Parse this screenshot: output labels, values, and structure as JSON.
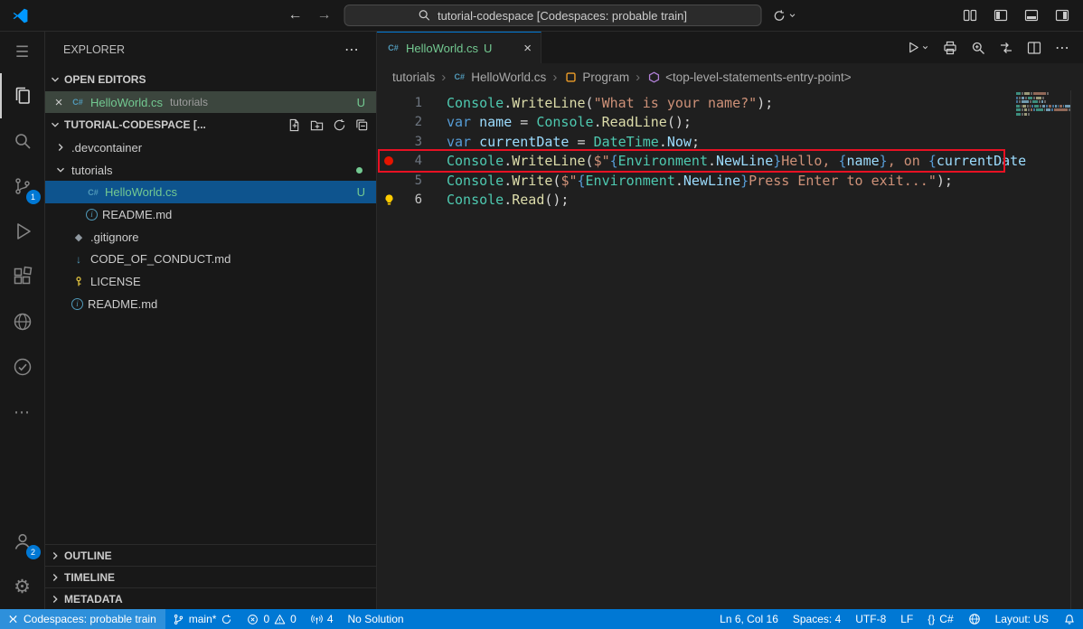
{
  "titlebar": {
    "search": "tutorial-codespace [Codespaces: probable train]"
  },
  "activitybar": {
    "scm_badge": "1",
    "account_badge": "2"
  },
  "explorer": {
    "title": "EXPLORER",
    "open_editors_label": "OPEN EDITORS",
    "open_editor": {
      "name": "HelloWorld.cs",
      "desc": "tutorials",
      "git": "U"
    },
    "workspace_label": "TUTORIAL-CODESPACE [...",
    "tree": [
      {
        "name": ".devcontainer",
        "kind": "folder",
        "expanded": false,
        "indent": 0
      },
      {
        "name": "tutorials",
        "kind": "folder",
        "expanded": true,
        "indent": 0,
        "dot": true
      },
      {
        "name": "HelloWorld.cs",
        "kind": "file",
        "icon": "csharp",
        "indent": 1,
        "selected": true,
        "git": "U"
      },
      {
        "name": "README.md",
        "kind": "file",
        "icon": "info",
        "indent": 1
      },
      {
        "name": ".gitignore",
        "kind": "file",
        "icon": "git",
        "indent": 0
      },
      {
        "name": "CODE_OF_CONDUCT.md",
        "kind": "file",
        "icon": "markdown",
        "indent": 0
      },
      {
        "name": "LICENSE",
        "kind": "file",
        "icon": "license",
        "indent": 0
      },
      {
        "name": "README.md",
        "kind": "file",
        "icon": "info",
        "indent": 0
      }
    ],
    "bottom_sections": [
      "OUTLINE",
      "TIMELINE",
      "METADATA"
    ]
  },
  "editor": {
    "tab": {
      "label": "HelloWorld.cs",
      "git": "U"
    },
    "breadcrumbs": [
      {
        "label": "tutorials",
        "icon": ""
      },
      {
        "label": "HelloWorld.cs",
        "icon": "csharp"
      },
      {
        "label": "Program",
        "icon": "class"
      },
      {
        "label": "<top-level-statements-entry-point>",
        "icon": "method"
      }
    ],
    "code": [
      {
        "deco": "",
        "tokens": [
          [
            "c",
            "Console"
          ],
          [
            "p",
            "."
          ],
          [
            "f",
            "WriteLine"
          ],
          [
            "p",
            "("
          ],
          [
            "s",
            "\"What is your name?\""
          ],
          [
            "p",
            ");"
          ]
        ]
      },
      {
        "deco": "",
        "tokens": [
          [
            "k",
            "var"
          ],
          [
            "p",
            " "
          ],
          [
            "v",
            "name"
          ],
          [
            "p",
            " = "
          ],
          [
            "c",
            "Console"
          ],
          [
            "p",
            "."
          ],
          [
            "f",
            "ReadLine"
          ],
          [
            "p",
            "();"
          ]
        ]
      },
      {
        "deco": "",
        "tokens": [
          [
            "k",
            "var"
          ],
          [
            "p",
            " "
          ],
          [
            "v",
            "currentDate"
          ],
          [
            "p",
            " = "
          ],
          [
            "c",
            "DateTime"
          ],
          [
            "p",
            "."
          ],
          [
            "v",
            "Now"
          ],
          [
            "p",
            ";"
          ]
        ]
      },
      {
        "deco": "breakpoint",
        "tokens": [
          [
            "c",
            "Console"
          ],
          [
            "p",
            "."
          ],
          [
            "f",
            "WriteLine"
          ],
          [
            "p",
            "("
          ],
          [
            "s",
            "$\""
          ],
          [
            "b",
            "{"
          ],
          [
            "c",
            "Environment"
          ],
          [
            "p",
            "."
          ],
          [
            "v",
            "NewLine"
          ],
          [
            "b",
            "}"
          ],
          [
            "s",
            "Hello, "
          ],
          [
            "b",
            "{"
          ],
          [
            "v",
            "name"
          ],
          [
            "b",
            "}"
          ],
          [
            "s",
            ", on "
          ],
          [
            "b",
            "{"
          ],
          [
            "v",
            "currentDate"
          ]
        ]
      },
      {
        "deco": "",
        "tokens": [
          [
            "c",
            "Console"
          ],
          [
            "p",
            "."
          ],
          [
            "f",
            "Write"
          ],
          [
            "p",
            "("
          ],
          [
            "s",
            "$\""
          ],
          [
            "b",
            "{"
          ],
          [
            "c",
            "Environment"
          ],
          [
            "p",
            "."
          ],
          [
            "v",
            "NewLine"
          ],
          [
            "b",
            "}"
          ],
          [
            "s",
            "Press Enter to exit...\""
          ],
          [
            "p",
            ");"
          ]
        ]
      },
      {
        "deco": "lightbulb",
        "tokens": [
          [
            "c",
            "Console"
          ],
          [
            "p",
            "."
          ],
          [
            "f",
            "Read"
          ],
          [
            "p",
            "();"
          ]
        ]
      }
    ]
  },
  "statusbar": {
    "remote": "Codespaces: probable train",
    "branch": "main*",
    "errors": "0",
    "warnings": "0",
    "ports": "4",
    "solution": "No Solution",
    "cursor": "Ln 6, Col 16",
    "spaces": "Spaces: 4",
    "encoding": "UTF-8",
    "eol": "LF",
    "braces": "{}",
    "language": "C#",
    "layout": "Layout: US"
  }
}
